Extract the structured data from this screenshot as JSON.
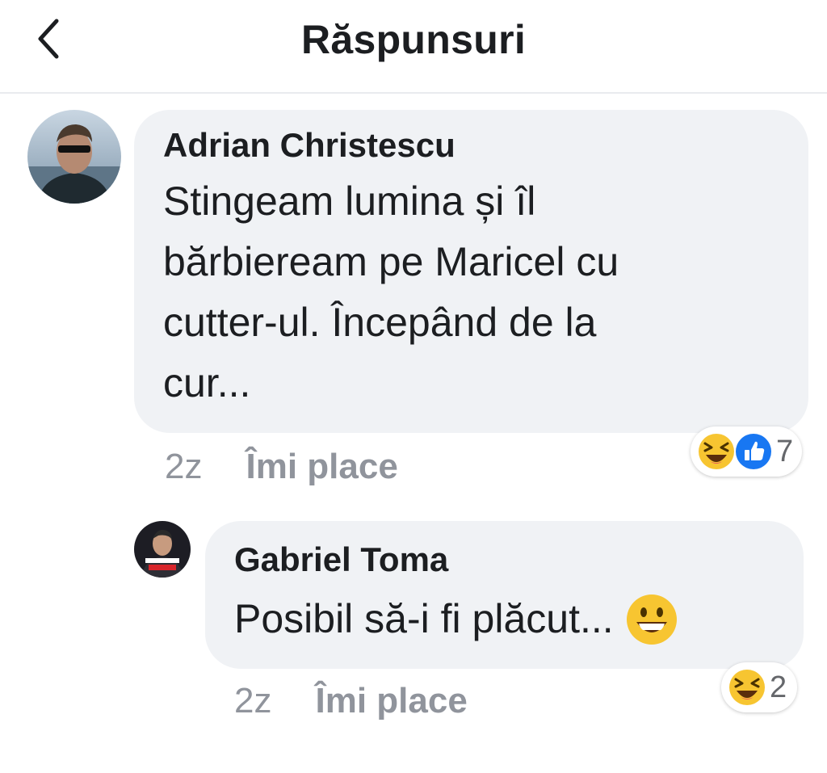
{
  "header": {
    "title": "Răspunsuri",
    "back_icon": "chevron-left-icon"
  },
  "comments": [
    {
      "author": "Adrian Christescu",
      "text_lines": [
        "Stingeam lumina și îl",
        "bărbieream pe Maricel cu",
        "cutter-ul. Începând de la",
        "cur..."
      ],
      "time": "2z",
      "like_label": "Îmi place",
      "reactions": [
        "laughing-emoji-icon",
        "like-thumb-icon"
      ],
      "reaction_count": "7"
    },
    {
      "author": "Gabriel Toma",
      "text": "Posibil să-i fi plăcut...",
      "text_emoji": "grinning-emoji-icon",
      "time": "2z",
      "like_label": "Îmi place",
      "reactions": [
        "laughing-emoji-icon"
      ],
      "reaction_count": "2"
    }
  ],
  "colors": {
    "bubble": "#f0f2f5",
    "meta_text": "#90949c",
    "like_blue": "#1877f2",
    "emoji_yellow": "#f7c531"
  }
}
